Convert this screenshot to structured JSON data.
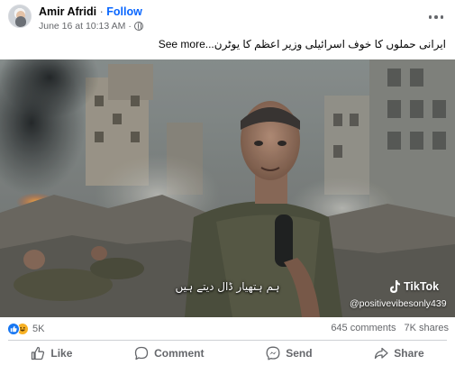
{
  "post": {
    "author": "Amir Afridi",
    "separator": "·",
    "follow_label": "Follow",
    "timestamp": "June 16 at 10:13 AM",
    "meta_separator": "·",
    "caption": "ایرانی حملوں کا خوف اسرائیلی وزیر اعظم کا یوٹرن...",
    "see_more_label": "See more"
  },
  "media": {
    "subtitle": "ہم ہتھیار ڈال دیتے ہیں",
    "watermark_brand": "TikTok",
    "watermark_handle": "@positivevibesonly439"
  },
  "stats": {
    "reaction_count": "5K",
    "comments": "645 comments",
    "shares": "7K shares"
  },
  "actions": {
    "like": "Like",
    "comment": "Comment",
    "send": "Send",
    "share": "Share"
  },
  "icons": {
    "avatar": "avatar",
    "globe": "globe-icon",
    "more": "more-options-icon",
    "like_reaction": "like-reaction-icon",
    "haha_reaction": "haha-reaction-icon",
    "like": "thumbs-up-icon",
    "comment": "comment-bubble-icon",
    "send": "messenger-icon",
    "share": "share-arrow-icon",
    "tiktok": "tiktok-logo-icon"
  },
  "colors": {
    "follow": "#0866ff",
    "like_reaction": "#1877f2",
    "haha_reaction": "#f7b125",
    "secondary_text": "#65676b"
  }
}
